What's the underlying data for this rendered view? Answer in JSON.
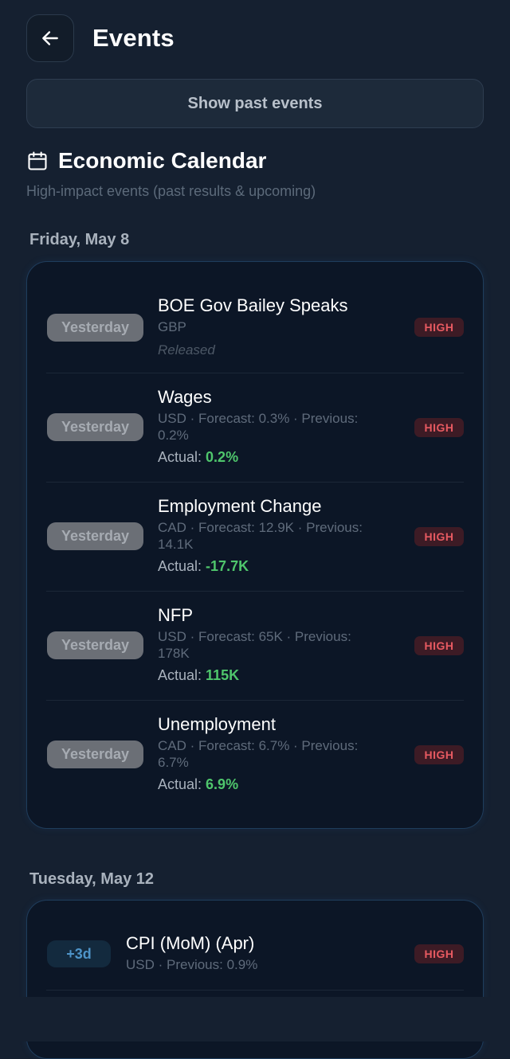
{
  "header": {
    "title": "Events",
    "back_icon": "arrow-left-icon"
  },
  "past_button": {
    "label": "Show past events"
  },
  "section": {
    "icon": "calendar-icon",
    "title": "Economic Calendar",
    "subtitle": "High-impact events (past results & upcoming)"
  },
  "days": [
    {
      "label": "Friday, May 8",
      "events": [
        {
          "when": "Yesterday",
          "title": "BOE Gov Bailey Speaks",
          "meta": "GBP",
          "status": "Released",
          "impact": "HIGH"
        },
        {
          "when": "Yesterday",
          "title": "Wages",
          "meta": "USD · Forecast: 0.3% · Previous: 0.2%",
          "actual_label": "Actual:",
          "actual_value": "0.2%",
          "impact": "HIGH"
        },
        {
          "when": "Yesterday",
          "title": "Employment Change",
          "meta": "CAD · Forecast: 12.9K · Previous: 14.1K",
          "actual_label": "Actual:",
          "actual_value": "-17.7K",
          "impact": "HIGH"
        },
        {
          "when": "Yesterday",
          "title": "NFP",
          "meta": "USD · Forecast: 65K · Previous: 178K",
          "actual_label": "Actual:",
          "actual_value": "115K",
          "impact": "HIGH"
        },
        {
          "when": "Yesterday",
          "title": "Unemployment",
          "meta": "CAD · Forecast: 6.7% · Previous: 6.7%",
          "actual_label": "Actual:",
          "actual_value": "6.9%",
          "impact": "HIGH"
        }
      ]
    },
    {
      "label": "Tuesday, May 12",
      "events": [
        {
          "when": "+3d",
          "title": "CPI (MoM) (Apr)",
          "meta": "USD · Previous: 0.9%",
          "impact": "HIGH"
        }
      ]
    }
  ],
  "colors": {
    "background": "#152030",
    "card": "#0c1626",
    "high_badge": "#e75a61",
    "actual_value": "#4fc66c",
    "upcoming_pill": "#4e94c8"
  }
}
